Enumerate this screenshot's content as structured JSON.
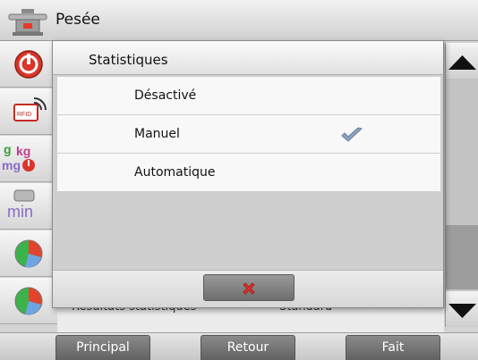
{
  "titlebar": {
    "title": "Pesée",
    "icon": "balance-icon"
  },
  "sidebar": {
    "items": [
      {
        "icon": "power-icon"
      },
      {
        "icon": "rfid-icon"
      },
      {
        "icon": "units-icon"
      },
      {
        "icon": "min-weight-icon"
      },
      {
        "icon": "pie-chart-icon"
      },
      {
        "icon": "pie-chart-icon"
      }
    ]
  },
  "background": {
    "row_left": "Résultats statistiques",
    "row_right": "Standard"
  },
  "dialog": {
    "title": "Statistiques",
    "options": [
      {
        "label": "Désactivé",
        "selected": false
      },
      {
        "label": "Manuel",
        "selected": true
      },
      {
        "label": "Automatique",
        "selected": false
      }
    ],
    "cancel_icon": "close-icon"
  },
  "bottom_nav": {
    "main_label": "Principal",
    "back_label": "Retour",
    "done_label": "Fait"
  },
  "colors": {
    "cancel_x": "#e0312a",
    "check": "#7e93b3",
    "nav_button": "#6e6e6e"
  }
}
